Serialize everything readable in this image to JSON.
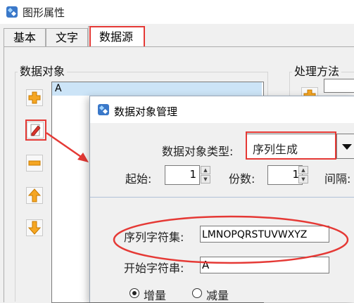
{
  "window": {
    "title": "图形属性"
  },
  "tabs": [
    {
      "label": "基本"
    },
    {
      "label": "文字"
    },
    {
      "label": "数据源"
    }
  ],
  "groups": {
    "data_object": "数据对象",
    "processing": "处理方法"
  },
  "object_list": {
    "items": [
      "A"
    ]
  },
  "side_buttons": [
    "add-icon",
    "edit-icon",
    "remove-icon",
    "move-up-icon",
    "move-down-icon"
  ],
  "dialog": {
    "title": "数据对象管理",
    "type_label": "数据对象类型:",
    "type_value": "序列生成",
    "start_label": "起始:",
    "start_value": "1",
    "copies_label": "份数:",
    "copies_value": "1",
    "interval_label": "间隔:",
    "sequence_charset_label": "序列字符集:",
    "sequence_charset_value": "LMNOPQRSTUVWXYZ",
    "start_string_label": "开始字符串:",
    "start_string_value": "A",
    "increment_label": "增量",
    "decrement_label": "减量"
  },
  "colors": {
    "annotation_red": "#e53935",
    "selection": "#cce4f7",
    "icon_orange": "#f5a623"
  }
}
